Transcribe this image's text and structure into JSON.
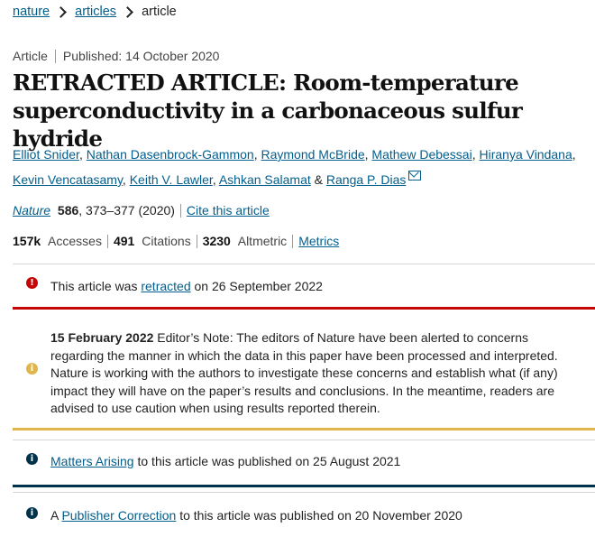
{
  "breadcrumb": [
    "nature",
    "articles",
    "article"
  ],
  "meta": {
    "type": "Article",
    "published": "Published: 14 October 2020"
  },
  "title": "RETRACTED ARTICLE: Room-temperature superconductivity in a carbonaceous sulfur hydride",
  "authors": [
    "Elliot Snider",
    "Nathan Dasenbrock-Gammon",
    "Raymond McBride",
    "Mathew Debessai",
    "Hiranya Vindana",
    "Kevin Vencatasamy",
    "Keith V. Lawler",
    "Ashkan Salamat",
    "Ranga P. Dias"
  ],
  "author_sep": ", ",
  "author_and": "&",
  "citation": {
    "journal": "Nature",
    "volume": "586",
    "pages": ", 373–377 (2020)",
    "cite_link": "Cite this article"
  },
  "metrics": {
    "accesses": "157k",
    "accesses_label": "Accesses",
    "citations": "491",
    "citations_label": "Citations",
    "altmetric": "3230",
    "altmetric_label": "Altmetric",
    "metrics_link": "Metrics"
  },
  "notices": {
    "retraction": {
      "pre": "This article was ",
      "link": "retracted",
      "post": " on 26 September 2022",
      "icon": "error-icon",
      "color": "#c40606"
    },
    "editors_note": {
      "date": "15 February 2022",
      "text": " Editor’s Note: The editors of Nature have been alerted to concerns regarding the manner in which the data in this paper have been processed and interpreted. Nature is working with the authors to investigate these concerns and establish what (if any) impact they will have on the paper’s results and conclusions. In the meantime, readers are advised to use caution when using results reported therein.",
      "icon": "info-icon",
      "color": "#e0b64c"
    },
    "matters_arising": {
      "link": "Matters Arising",
      "post": " to this article was published on 25 August 2021",
      "icon": "info-icon",
      "color": "#01324b"
    },
    "publisher_correction": {
      "pre": "A ",
      "link": "Publisher Correction",
      "post": " to this article was published on 20 November 2020",
      "icon": "info-icon",
      "color": "#01324b"
    }
  }
}
